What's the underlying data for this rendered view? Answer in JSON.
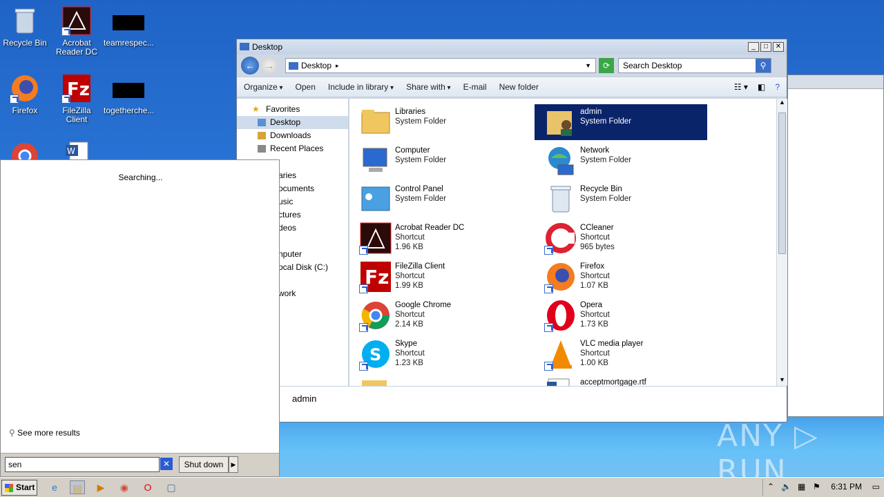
{
  "desktop": {
    "icons": [
      {
        "label": "Recycle Bin"
      },
      {
        "label": "Acrobat Reader DC"
      },
      {
        "label": "teamrespec..."
      },
      {
        "label": "Firefox"
      },
      {
        "label": "FileZilla Client"
      },
      {
        "label": "togetherche..."
      }
    ],
    "watermark": "ANY ▷ RUN"
  },
  "explorer": {
    "title": "Desktop",
    "address": "Desktop",
    "search_placeholder": "Search Desktop",
    "toolbar": {
      "organize": "Organize",
      "open": "Open",
      "include_in_library": "Include in library",
      "share_with": "Share with",
      "email": "E-mail",
      "new_folder": "New folder"
    },
    "nav": {
      "favorites": "Favorites",
      "desktop": "Desktop",
      "downloads": "Downloads",
      "recent_places": "Recent Places",
      "libraries_cut": "aries",
      "documents_cut": "ocuments",
      "music_cut": "usic",
      "pictures_cut": "ctures",
      "videos_cut": "deos",
      "computer_cut": "nputer",
      "localdisk_cut": "ocal Disk (C:)",
      "network_cut": "work"
    },
    "items": [
      {
        "name": "Libraries",
        "type": "System Folder",
        "size": ""
      },
      {
        "name": "admin",
        "type": "System Folder",
        "size": ""
      },
      {
        "name": "Computer",
        "type": "System Folder",
        "size": ""
      },
      {
        "name": "Network",
        "type": "System Folder",
        "size": ""
      },
      {
        "name": "Control Panel",
        "type": "System Folder",
        "size": ""
      },
      {
        "name": "Recycle Bin",
        "type": "System Folder",
        "size": ""
      },
      {
        "name": "Acrobat Reader DC",
        "type": "Shortcut",
        "size": "1.96 KB"
      },
      {
        "name": "CCleaner",
        "type": "Shortcut",
        "size": "965 bytes"
      },
      {
        "name": "FileZilla Client",
        "type": "Shortcut",
        "size": "1.99 KB"
      },
      {
        "name": "Firefox",
        "type": "Shortcut",
        "size": "1.07 KB"
      },
      {
        "name": "Google Chrome",
        "type": "Shortcut",
        "size": "2.14 KB"
      },
      {
        "name": "Opera",
        "type": "Shortcut",
        "size": "1.73 KB"
      },
      {
        "name": "Skype",
        "type": "Shortcut",
        "size": "1.23 KB"
      },
      {
        "name": "VLC media player",
        "type": "Shortcut",
        "size": "1.00 KB"
      },
      {
        "name": "acceptmortgage.rtf",
        "type": "",
        "size": ""
      }
    ],
    "details_name": "admin"
  },
  "startmenu": {
    "status": "Searching...",
    "see_more": "See more results",
    "query": "sen",
    "shutdown": "Shut down"
  },
  "taskbar": {
    "start": "Start",
    "clock": "6:31 PM"
  }
}
